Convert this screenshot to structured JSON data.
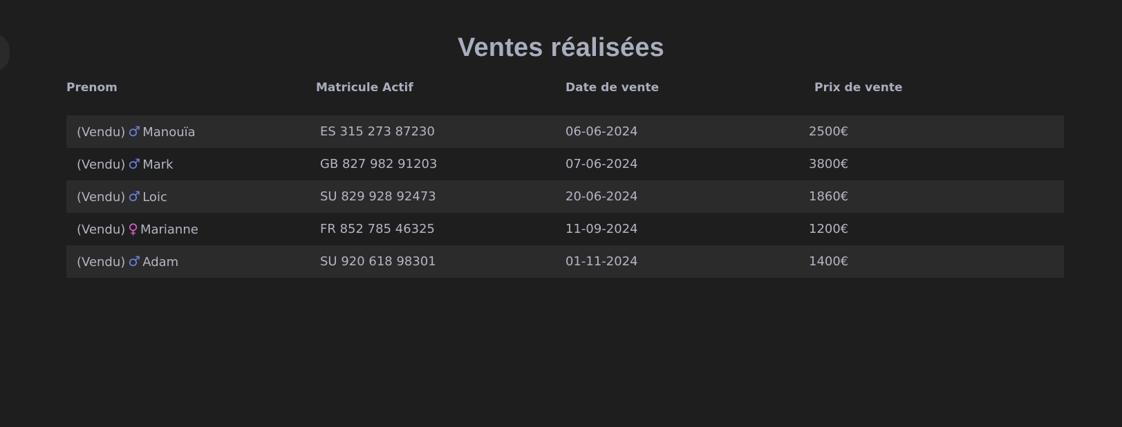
{
  "title": "Ventes réalisées",
  "columns": [
    "Prenom",
    "Matricule Actif",
    "Date de vente",
    "Prix de vente"
  ],
  "status_prefix": "(Vendu)",
  "gender_icons": {
    "male": "♂",
    "female": "♀"
  },
  "colors": {
    "male": "#6f7fd9",
    "female": "#d65fc6"
  },
  "rows": [
    {
      "gender": "male",
      "name": "Manouïa",
      "matricule": "ES 315 273 87230",
      "date": "06-06-2024",
      "price": "2500€"
    },
    {
      "gender": "male",
      "name": "Mark",
      "matricule": "GB 827 982 91203",
      "date": "07-06-2024",
      "price": "3800€"
    },
    {
      "gender": "male",
      "name": "Loic",
      "matricule": "SU 829 928 92473",
      "date": "20-06-2024",
      "price": "1860€"
    },
    {
      "gender": "female",
      "name": "Marianne",
      "matricule": "FR 852 785 46325",
      "date": "11-09-2024",
      "price": "1200€"
    },
    {
      "gender": "male",
      "name": "Adam",
      "matricule": "SU 920 618 98301",
      "date": "01-11-2024",
      "price": "1400€"
    }
  ]
}
